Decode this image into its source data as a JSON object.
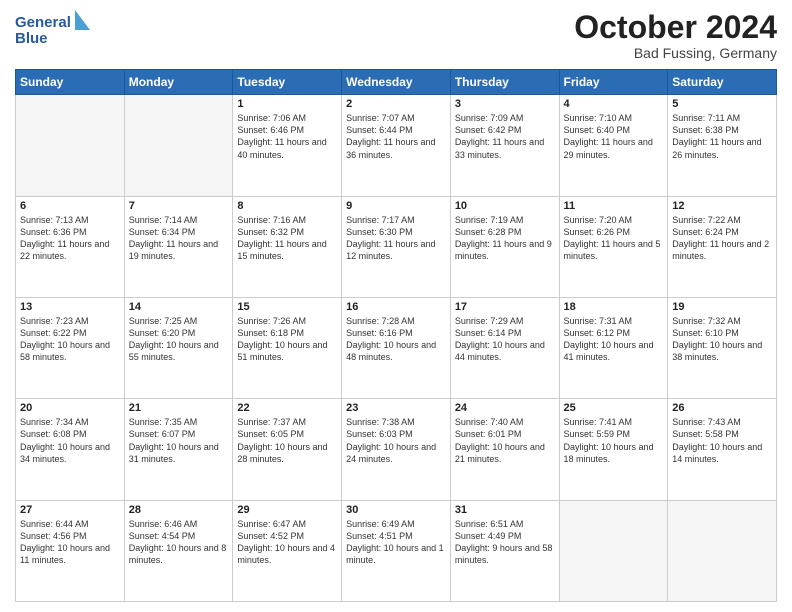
{
  "header": {
    "logo_line1": "General",
    "logo_line2": "Blue",
    "month_title": "October 2024",
    "location": "Bad Fussing, Germany"
  },
  "weekdays": [
    "Sunday",
    "Monday",
    "Tuesday",
    "Wednesday",
    "Thursday",
    "Friday",
    "Saturday"
  ],
  "weeks": [
    [
      {
        "day": "",
        "info": ""
      },
      {
        "day": "",
        "info": ""
      },
      {
        "day": "1",
        "info": "Sunrise: 7:06 AM\nSunset: 6:46 PM\nDaylight: 11 hours and 40 minutes."
      },
      {
        "day": "2",
        "info": "Sunrise: 7:07 AM\nSunset: 6:44 PM\nDaylight: 11 hours and 36 minutes."
      },
      {
        "day": "3",
        "info": "Sunrise: 7:09 AM\nSunset: 6:42 PM\nDaylight: 11 hours and 33 minutes."
      },
      {
        "day": "4",
        "info": "Sunrise: 7:10 AM\nSunset: 6:40 PM\nDaylight: 11 hours and 29 minutes."
      },
      {
        "day": "5",
        "info": "Sunrise: 7:11 AM\nSunset: 6:38 PM\nDaylight: 11 hours and 26 minutes."
      }
    ],
    [
      {
        "day": "6",
        "info": "Sunrise: 7:13 AM\nSunset: 6:36 PM\nDaylight: 11 hours and 22 minutes."
      },
      {
        "day": "7",
        "info": "Sunrise: 7:14 AM\nSunset: 6:34 PM\nDaylight: 11 hours and 19 minutes."
      },
      {
        "day": "8",
        "info": "Sunrise: 7:16 AM\nSunset: 6:32 PM\nDaylight: 11 hours and 15 minutes."
      },
      {
        "day": "9",
        "info": "Sunrise: 7:17 AM\nSunset: 6:30 PM\nDaylight: 11 hours and 12 minutes."
      },
      {
        "day": "10",
        "info": "Sunrise: 7:19 AM\nSunset: 6:28 PM\nDaylight: 11 hours and 9 minutes."
      },
      {
        "day": "11",
        "info": "Sunrise: 7:20 AM\nSunset: 6:26 PM\nDaylight: 11 hours and 5 minutes."
      },
      {
        "day": "12",
        "info": "Sunrise: 7:22 AM\nSunset: 6:24 PM\nDaylight: 11 hours and 2 minutes."
      }
    ],
    [
      {
        "day": "13",
        "info": "Sunrise: 7:23 AM\nSunset: 6:22 PM\nDaylight: 10 hours and 58 minutes."
      },
      {
        "day": "14",
        "info": "Sunrise: 7:25 AM\nSunset: 6:20 PM\nDaylight: 10 hours and 55 minutes."
      },
      {
        "day": "15",
        "info": "Sunrise: 7:26 AM\nSunset: 6:18 PM\nDaylight: 10 hours and 51 minutes."
      },
      {
        "day": "16",
        "info": "Sunrise: 7:28 AM\nSunset: 6:16 PM\nDaylight: 10 hours and 48 minutes."
      },
      {
        "day": "17",
        "info": "Sunrise: 7:29 AM\nSunset: 6:14 PM\nDaylight: 10 hours and 44 minutes."
      },
      {
        "day": "18",
        "info": "Sunrise: 7:31 AM\nSunset: 6:12 PM\nDaylight: 10 hours and 41 minutes."
      },
      {
        "day": "19",
        "info": "Sunrise: 7:32 AM\nSunset: 6:10 PM\nDaylight: 10 hours and 38 minutes."
      }
    ],
    [
      {
        "day": "20",
        "info": "Sunrise: 7:34 AM\nSunset: 6:08 PM\nDaylight: 10 hours and 34 minutes."
      },
      {
        "day": "21",
        "info": "Sunrise: 7:35 AM\nSunset: 6:07 PM\nDaylight: 10 hours and 31 minutes."
      },
      {
        "day": "22",
        "info": "Sunrise: 7:37 AM\nSunset: 6:05 PM\nDaylight: 10 hours and 28 minutes."
      },
      {
        "day": "23",
        "info": "Sunrise: 7:38 AM\nSunset: 6:03 PM\nDaylight: 10 hours and 24 minutes."
      },
      {
        "day": "24",
        "info": "Sunrise: 7:40 AM\nSunset: 6:01 PM\nDaylight: 10 hours and 21 minutes."
      },
      {
        "day": "25",
        "info": "Sunrise: 7:41 AM\nSunset: 5:59 PM\nDaylight: 10 hours and 18 minutes."
      },
      {
        "day": "26",
        "info": "Sunrise: 7:43 AM\nSunset: 5:58 PM\nDaylight: 10 hours and 14 minutes."
      }
    ],
    [
      {
        "day": "27",
        "info": "Sunrise: 6:44 AM\nSunset: 4:56 PM\nDaylight: 10 hours and 11 minutes."
      },
      {
        "day": "28",
        "info": "Sunrise: 6:46 AM\nSunset: 4:54 PM\nDaylight: 10 hours and 8 minutes."
      },
      {
        "day": "29",
        "info": "Sunrise: 6:47 AM\nSunset: 4:52 PM\nDaylight: 10 hours and 4 minutes."
      },
      {
        "day": "30",
        "info": "Sunrise: 6:49 AM\nSunset: 4:51 PM\nDaylight: 10 hours and 1 minute."
      },
      {
        "day": "31",
        "info": "Sunrise: 6:51 AM\nSunset: 4:49 PM\nDaylight: 9 hours and 58 minutes."
      },
      {
        "day": "",
        "info": ""
      },
      {
        "day": "",
        "info": ""
      }
    ]
  ]
}
